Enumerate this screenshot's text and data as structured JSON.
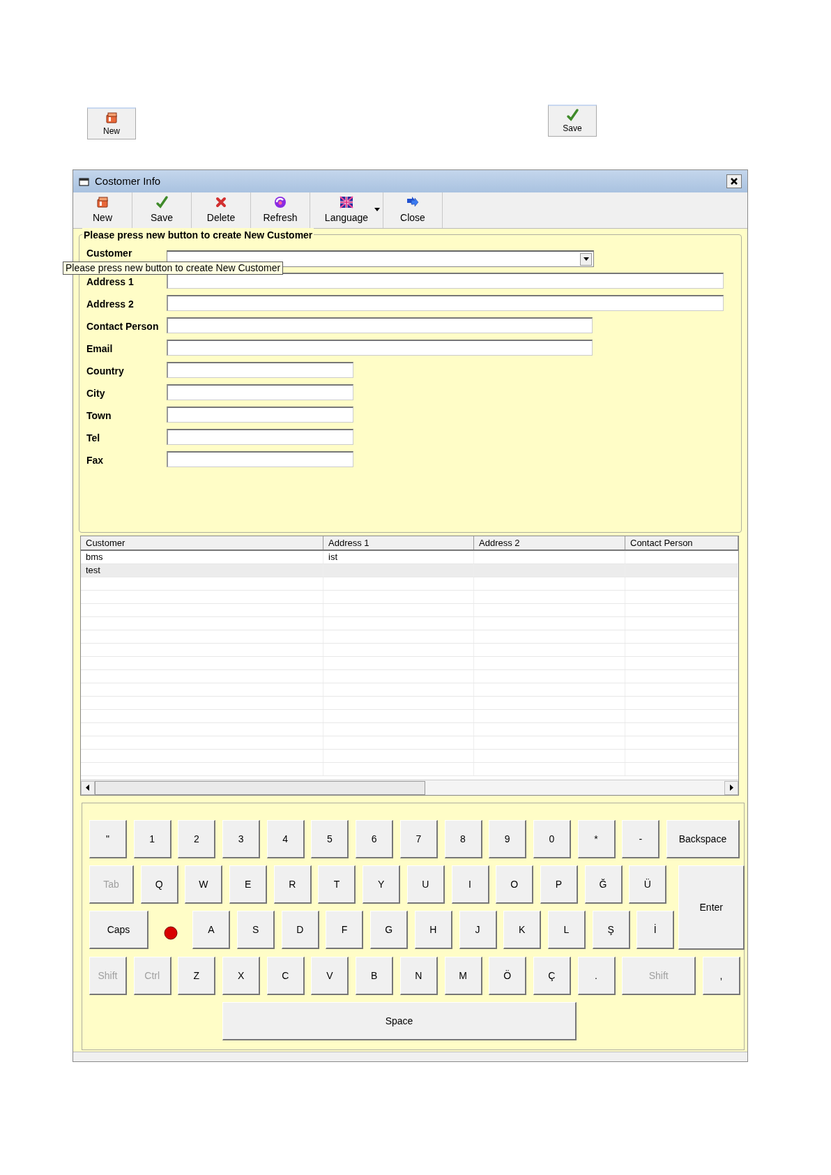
{
  "quick_buttons": [
    {
      "kind": "new",
      "label": "New"
    },
    {
      "kind": "save",
      "label": "Save"
    }
  ],
  "window": {
    "title": "Costomer Info"
  },
  "toolbar": [
    {
      "kind": "new",
      "label": "New"
    },
    {
      "kind": "save",
      "label": "Save"
    },
    {
      "kind": "delete",
      "label": "Delete"
    },
    {
      "kind": "refresh",
      "label": "Refresh"
    },
    {
      "kind": "language",
      "label": "Language",
      "has_dropdown": true
    },
    {
      "kind": "close",
      "label": "Close"
    }
  ],
  "form": {
    "title": "Please press new button to create New Customer",
    "fields": [
      {
        "label": "Customer",
        "kind": "combo"
      },
      {
        "label": "Address 1",
        "kind": "wide"
      },
      {
        "label": "Address 2",
        "kind": "wide"
      },
      {
        "label": "Contact Person",
        "kind": "medium"
      },
      {
        "label": "Email",
        "kind": "medium"
      },
      {
        "label": "Country",
        "kind": "short"
      },
      {
        "label": "City",
        "kind": "short"
      },
      {
        "label": "Town",
        "kind": "short"
      },
      {
        "label": "Tel",
        "kind": "short"
      },
      {
        "label": "Fax",
        "kind": "short"
      }
    ]
  },
  "tooltip": "Please press new button to create New Customer",
  "table": {
    "columns": [
      "Customer",
      "Address 1",
      "Address 2",
      "Contact Person"
    ],
    "rows": [
      {
        "cells": [
          "bms",
          "ist"
        ],
        "selected": false
      },
      {
        "cells": [
          "test"
        ],
        "selected": true
      }
    ]
  },
  "keyboard": {
    "caps_indicator": {
      "on": true
    },
    "rows": [
      [
        {
          "label": "\"",
          "kind": "key",
          "disabled": false
        },
        {
          "label": "1",
          "kind": "key",
          "disabled": false
        },
        {
          "label": "2",
          "kind": "key",
          "disabled": false
        },
        {
          "label": "3",
          "kind": "key",
          "disabled": false
        },
        {
          "label": "4",
          "kind": "key",
          "disabled": false
        },
        {
          "label": "5",
          "kind": "key",
          "disabled": false
        },
        {
          "label": "6",
          "kind": "key",
          "disabled": false
        },
        {
          "label": "7",
          "kind": "key",
          "disabled": false
        },
        {
          "label": "8",
          "kind": "key",
          "disabled": false
        },
        {
          "label": "9",
          "kind": "key",
          "disabled": false
        },
        {
          "label": "0",
          "kind": "key",
          "disabled": false
        },
        {
          "label": "*",
          "kind": "key",
          "disabled": false
        },
        {
          "label": "-",
          "kind": "key",
          "disabled": false
        },
        {
          "label": "Backspace",
          "kind": "backspace",
          "disabled": false
        }
      ],
      [
        {
          "label": "Tab",
          "kind": "tab",
          "disabled": true
        },
        {
          "label": "Q",
          "kind": "key",
          "disabled": false
        },
        {
          "label": "W",
          "kind": "key",
          "disabled": false
        },
        {
          "label": "E",
          "kind": "key",
          "disabled": false
        },
        {
          "label": "R",
          "kind": "key",
          "disabled": false
        },
        {
          "label": "T",
          "kind": "key",
          "disabled": false
        },
        {
          "label": "Y",
          "kind": "key",
          "disabled": false
        },
        {
          "label": "U",
          "kind": "key",
          "disabled": false
        },
        {
          "label": "I",
          "kind": "key",
          "disabled": false
        },
        {
          "label": "O",
          "kind": "key",
          "disabled": false
        },
        {
          "label": "P",
          "kind": "key",
          "disabled": false
        },
        {
          "label": "Ğ",
          "kind": "key",
          "disabled": false
        },
        {
          "label": "Ü",
          "kind": "key",
          "disabled": false
        },
        {
          "label": "Enter",
          "kind": "enter",
          "disabled": false
        }
      ],
      [
        {
          "label": "Caps",
          "kind": "caps",
          "disabled": false
        },
        {
          "label": "A",
          "kind": "key",
          "disabled": false
        },
        {
          "label": "S",
          "kind": "key",
          "disabled": false
        },
        {
          "label": "D",
          "kind": "key",
          "disabled": false
        },
        {
          "label": "F",
          "kind": "key",
          "disabled": false
        },
        {
          "label": "G",
          "kind": "key",
          "disabled": false
        },
        {
          "label": "H",
          "kind": "key",
          "disabled": false
        },
        {
          "label": "J",
          "kind": "key",
          "disabled": false
        },
        {
          "label": "K",
          "kind": "key",
          "disabled": false
        },
        {
          "label": "L",
          "kind": "key",
          "disabled": false
        },
        {
          "label": "Ş",
          "kind": "key",
          "disabled": false
        },
        {
          "label": "İ",
          "kind": "key",
          "disabled": false
        }
      ],
      [
        {
          "label": "Shift",
          "kind": "key",
          "disabled": true
        },
        {
          "label": "Ctrl",
          "kind": "key",
          "disabled": true
        },
        {
          "label": "Z",
          "kind": "key",
          "disabled": false
        },
        {
          "label": "X",
          "kind": "key",
          "disabled": false
        },
        {
          "label": "C",
          "kind": "key",
          "disabled": false
        },
        {
          "label": "V",
          "kind": "key",
          "disabled": false
        },
        {
          "label": "B",
          "kind": "key",
          "disabled": false
        },
        {
          "label": "N",
          "kind": "key",
          "disabled": false
        },
        {
          "label": "M",
          "kind": "key",
          "disabled": false
        },
        {
          "label": "Ö",
          "kind": "key",
          "disabled": false
        },
        {
          "label": "Ç",
          "kind": "key",
          "disabled": false
        },
        {
          "label": ".",
          "kind": "key",
          "disabled": false
        },
        {
          "label": "Shift",
          "kind": "shift",
          "disabled": true
        },
        {
          "label": ",",
          "kind": "key",
          "disabled": false
        }
      ],
      [
        {
          "label": "Space",
          "kind": "space",
          "disabled": false
        }
      ]
    ]
  }
}
